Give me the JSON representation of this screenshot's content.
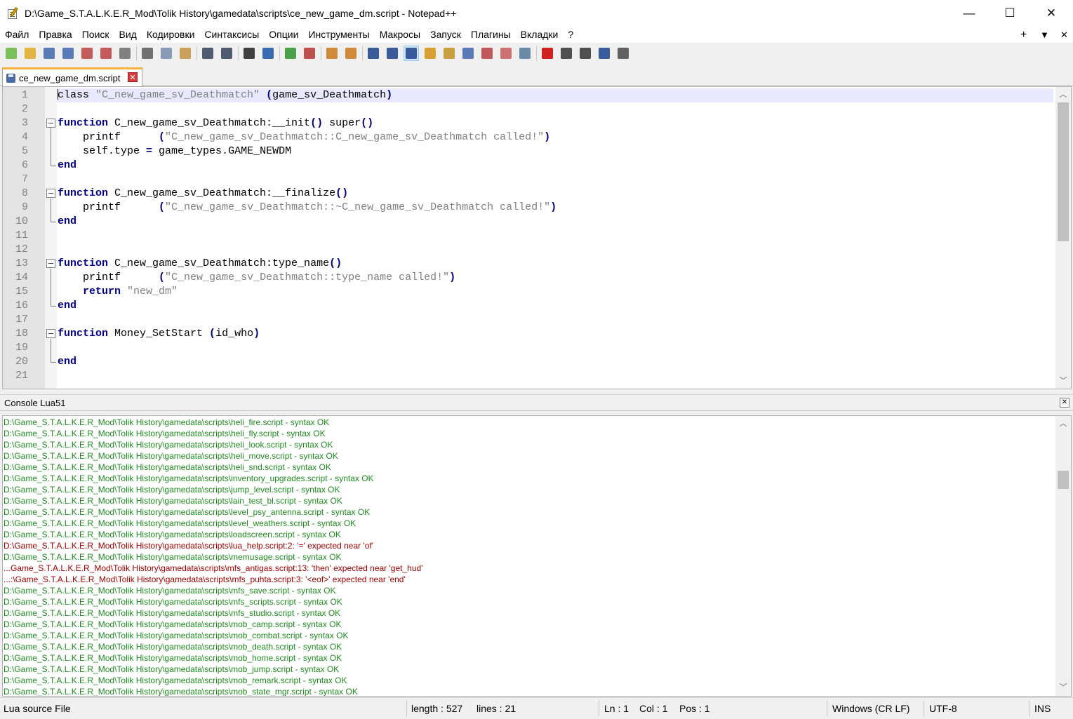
{
  "window": {
    "title": "D:\\Game_S.T.A.L.K.E.R_Mod\\Tolik History\\gamedata\\scripts\\ce_new_game_dm.script - Notepad++",
    "minimize_glyph": "—",
    "maximize_glyph": "☐",
    "close_glyph": "✕"
  },
  "menu": {
    "items": [
      "Файл",
      "Правка",
      "Поиск",
      "Вид",
      "Кодировки",
      "Синтаксисы",
      "Опции",
      "Инструменты",
      "Макросы",
      "Запуск",
      "Плагины",
      "Вкладки",
      "?"
    ],
    "right_plus": "+",
    "right_dropdown": "▼",
    "right_close": "✕"
  },
  "toolbar": {
    "buttons": [
      {
        "icon": "new-file-icon",
        "color": "#7bbf5a"
      },
      {
        "icon": "open-file-icon",
        "color": "#e3b43f"
      },
      {
        "icon": "save-icon",
        "color": "#5a7ab8"
      },
      {
        "icon": "save-all-icon",
        "color": "#5a7ab8"
      },
      {
        "icon": "close-file-icon",
        "color": "#c45a5a"
      },
      {
        "icon": "close-all-icon",
        "color": "#c45a5a"
      },
      {
        "icon": "print-icon",
        "color": "#808080"
      },
      {
        "sep": true
      },
      {
        "icon": "cut-icon",
        "color": "#707070"
      },
      {
        "icon": "copy-icon",
        "color": "#8a9bb8"
      },
      {
        "icon": "paste-icon",
        "color": "#c9a15a"
      },
      {
        "sep": true
      },
      {
        "icon": "undo-icon",
        "color": "#505a70"
      },
      {
        "icon": "redo-icon",
        "color": "#505a70"
      },
      {
        "sep": true
      },
      {
        "icon": "find-icon",
        "color": "#404040"
      },
      {
        "icon": "replace-icon",
        "color": "#3a6ab0"
      },
      {
        "sep": true
      },
      {
        "icon": "zoom-in-icon",
        "color": "#4aa04a"
      },
      {
        "icon": "zoom-out-icon",
        "color": "#c05050"
      },
      {
        "sep": true
      },
      {
        "icon": "sync-vertical-icon",
        "color": "#d08a3a"
      },
      {
        "icon": "sync-horizontal-icon",
        "color": "#d08a3a"
      },
      {
        "sep": true
      },
      {
        "icon": "word-wrap-icon",
        "color": "#3a5a9a"
      },
      {
        "icon": "show-all-chars-icon",
        "color": "#3a5a9a"
      },
      {
        "icon": "indent-guide-icon",
        "color": "#3a5a9a",
        "active": true
      },
      {
        "icon": "udl-icon",
        "color": "#d8a030"
      },
      {
        "icon": "doc-map-icon",
        "color": "#c8a040"
      },
      {
        "icon": "function-list-icon",
        "color": "#5a7ab8"
      },
      {
        "icon": "folder-workspace-icon",
        "color": "#c05a5a"
      },
      {
        "icon": "folder-icon",
        "color": "#d07070"
      },
      {
        "icon": "monitoring-icon",
        "color": "#6a8aa8"
      },
      {
        "sep": true
      },
      {
        "icon": "record-macro-icon",
        "color": "#d02020"
      },
      {
        "icon": "stop-record-icon",
        "color": "#505050"
      },
      {
        "icon": "play-macro-icon",
        "color": "#505050"
      },
      {
        "icon": "run-macro-multiple-icon",
        "color": "#3a5a9a"
      },
      {
        "icon": "save-macro-icon",
        "color": "#606060"
      }
    ]
  },
  "tab": {
    "label": "ce_new_game_dm.script",
    "close_glyph": "✕"
  },
  "editor": {
    "lines": [
      [
        {
          "t": "class ",
          "c": ""
        },
        {
          "t": "\"C_new_game_sv_Deathmatch\"",
          "c": "str"
        },
        {
          "t": " ",
          "c": ""
        },
        {
          "t": "(",
          "c": "op"
        },
        {
          "t": "game_sv_Deathmatch",
          "c": ""
        },
        {
          "t": ")",
          "c": "op"
        }
      ],
      [],
      [
        {
          "t": "function",
          "c": "kw"
        },
        {
          "t": " C_new_game_sv_Deathmatch:__init",
          "c": ""
        },
        {
          "t": "()",
          "c": "op"
        },
        {
          "t": " super",
          "c": ""
        },
        {
          "t": "()",
          "c": "op"
        }
      ],
      [
        {
          "t": "    printf      ",
          "c": ""
        },
        {
          "t": "(",
          "c": "op"
        },
        {
          "t": "\"C_new_game_sv_Deathmatch::C_new_game_sv_Deathmatch called!\"",
          "c": "str"
        },
        {
          "t": ")",
          "c": "op"
        }
      ],
      [
        {
          "t": "    self.type ",
          "c": ""
        },
        {
          "t": "=",
          "c": "op"
        },
        {
          "t": " game_types.GAME_NEWDM",
          "c": ""
        }
      ],
      [
        {
          "t": "end",
          "c": "kw"
        }
      ],
      [],
      [
        {
          "t": "function",
          "c": "kw"
        },
        {
          "t": " C_new_game_sv_Deathmatch:__finalize",
          "c": ""
        },
        {
          "t": "()",
          "c": "op"
        }
      ],
      [
        {
          "t": "    printf      ",
          "c": ""
        },
        {
          "t": "(",
          "c": "op"
        },
        {
          "t": "\"C_new_game_sv_Deathmatch::~C_new_game_sv_Deathmatch called!\"",
          "c": "str"
        },
        {
          "t": ")",
          "c": "op"
        }
      ],
      [
        {
          "t": "end",
          "c": "kw"
        }
      ],
      [],
      [],
      [
        {
          "t": "function",
          "c": "kw"
        },
        {
          "t": " C_new_game_sv_Deathmatch:type_name",
          "c": ""
        },
        {
          "t": "()",
          "c": "op"
        }
      ],
      [
        {
          "t": "    printf      ",
          "c": ""
        },
        {
          "t": "(",
          "c": "op"
        },
        {
          "t": "\"C_new_game_sv_Deathmatch::type_name called!\"",
          "c": "str"
        },
        {
          "t": ")",
          "c": "op"
        }
      ],
      [
        {
          "t": "    ",
          "c": ""
        },
        {
          "t": "return",
          "c": "kw"
        },
        {
          "t": " ",
          "c": ""
        },
        {
          "t": "\"new_dm\"",
          "c": "str"
        }
      ],
      [
        {
          "t": "end",
          "c": "kw"
        }
      ],
      [],
      [
        {
          "t": "function",
          "c": "kw"
        },
        {
          "t": " Money_SetStart ",
          "c": ""
        },
        {
          "t": "(",
          "c": "op"
        },
        {
          "t": "id_who",
          "c": ""
        },
        {
          "t": ")",
          "c": "op"
        }
      ],
      [],
      [
        {
          "t": "end",
          "c": "kw"
        }
      ],
      []
    ],
    "line_numbers": [
      "1",
      "2",
      "3",
      "4",
      "5",
      "6",
      "7",
      "8",
      "9",
      "10",
      "11",
      "12",
      "13",
      "14",
      "15",
      "16",
      "17",
      "18",
      "19",
      "20",
      "21"
    ],
    "scroll_up": "︿",
    "scroll_down": "﹀"
  },
  "console": {
    "title": "Console Lua51",
    "close_glyph": "✕",
    "lines": [
      {
        "text": "D:\\Game_S.T.A.L.K.E.R_Mod\\Tolik History\\gamedata\\scripts\\heli_fire.script - syntax OK",
        "status": "ok"
      },
      {
        "text": "D:\\Game_S.T.A.L.K.E.R_Mod\\Tolik History\\gamedata\\scripts\\heli_fly.script - syntax OK",
        "status": "ok"
      },
      {
        "text": "D:\\Game_S.T.A.L.K.E.R_Mod\\Tolik History\\gamedata\\scripts\\heli_look.script - syntax OK",
        "status": "ok"
      },
      {
        "text": "D:\\Game_S.T.A.L.K.E.R_Mod\\Tolik History\\gamedata\\scripts\\heli_move.script - syntax OK",
        "status": "ok"
      },
      {
        "text": "D:\\Game_S.T.A.L.K.E.R_Mod\\Tolik History\\gamedata\\scripts\\heli_snd.script - syntax OK",
        "status": "ok"
      },
      {
        "text": "D:\\Game_S.T.A.L.K.E.R_Mod\\Tolik History\\gamedata\\scripts\\inventory_upgrades.script - syntax OK",
        "status": "ok"
      },
      {
        "text": "D:\\Game_S.T.A.L.K.E.R_Mod\\Tolik History\\gamedata\\scripts\\jump_level.script - syntax OK",
        "status": "ok"
      },
      {
        "text": "D:\\Game_S.T.A.L.K.E.R_Mod\\Tolik History\\gamedata\\scripts\\lain_test_bl.script - syntax OK",
        "status": "ok"
      },
      {
        "text": "D:\\Game_S.T.A.L.K.E.R_Mod\\Tolik History\\gamedata\\scripts\\level_psy_antenna.script - syntax OK",
        "status": "ok"
      },
      {
        "text": "D:\\Game_S.T.A.L.K.E.R_Mod\\Tolik History\\gamedata\\scripts\\level_weathers.script - syntax OK",
        "status": "ok"
      },
      {
        "text": "D:\\Game_S.T.A.L.K.E.R_Mod\\Tolik History\\gamedata\\scripts\\loadscreen.script - syntax OK",
        "status": "ok"
      },
      {
        "text": "D:\\Game_S.T.A.L.K.E.R_Mod\\Tolik History\\gamedata\\scripts\\lua_help.script:2: '=' expected near 'of'",
        "status": "err"
      },
      {
        "text": "D:\\Game_S.T.A.L.K.E.R_Mod\\Tolik History\\gamedata\\scripts\\memusage.script - syntax OK",
        "status": "ok"
      },
      {
        "text": "...Game_S.T.A.L.K.E.R_Mod\\Tolik History\\gamedata\\scripts\\mfs_antigas.script:13: 'then' expected near 'get_hud'",
        "status": "err"
      },
      {
        "text": "...:\\Game_S.T.A.L.K.E.R_Mod\\Tolik History\\gamedata\\scripts\\mfs_puhta.script:3: '<eof>' expected near 'end'",
        "status": "err"
      },
      {
        "text": "D:\\Game_S.T.A.L.K.E.R_Mod\\Tolik History\\gamedata\\scripts\\mfs_save.script - syntax OK",
        "status": "ok"
      },
      {
        "text": "D:\\Game_S.T.A.L.K.E.R_Mod\\Tolik History\\gamedata\\scripts\\mfs_scripts.script - syntax OK",
        "status": "ok"
      },
      {
        "text": "D:\\Game_S.T.A.L.K.E.R_Mod\\Tolik History\\gamedata\\scripts\\mfs_studio.script - syntax OK",
        "status": "ok"
      },
      {
        "text": "D:\\Game_S.T.A.L.K.E.R_Mod\\Tolik History\\gamedata\\scripts\\mob_camp.script - syntax OK",
        "status": "ok"
      },
      {
        "text": "D:\\Game_S.T.A.L.K.E.R_Mod\\Tolik History\\gamedata\\scripts\\mob_combat.script - syntax OK",
        "status": "ok"
      },
      {
        "text": "D:\\Game_S.T.A.L.K.E.R_Mod\\Tolik History\\gamedata\\scripts\\mob_death.script - syntax OK",
        "status": "ok"
      },
      {
        "text": "D:\\Game_S.T.A.L.K.E.R_Mod\\Tolik History\\gamedata\\scripts\\mob_home.script - syntax OK",
        "status": "ok"
      },
      {
        "text": "D:\\Game_S.T.A.L.K.E.R_Mod\\Tolik History\\gamedata\\scripts\\mob_jump.script - syntax OK",
        "status": "ok"
      },
      {
        "text": "D:\\Game_S.T.A.L.K.E.R_Mod\\Tolik History\\gamedata\\scripts\\mob_remark.script - syntax OK",
        "status": "ok"
      },
      {
        "text": "D:\\Game_S.T.A.L.K.E.R_Mod\\Tolik History\\gamedata\\scripts\\mob_state_mgr.script - syntax OK",
        "status": "ok"
      }
    ]
  },
  "status": {
    "file_type": "Lua source File",
    "length": "length : 527",
    "lines": "lines : 21",
    "ln": "Ln : 1",
    "col": "Col : 1",
    "pos": "Pos : 1",
    "eol": "Windows (CR LF)",
    "encoding": "UTF-8",
    "mode": "INS"
  }
}
